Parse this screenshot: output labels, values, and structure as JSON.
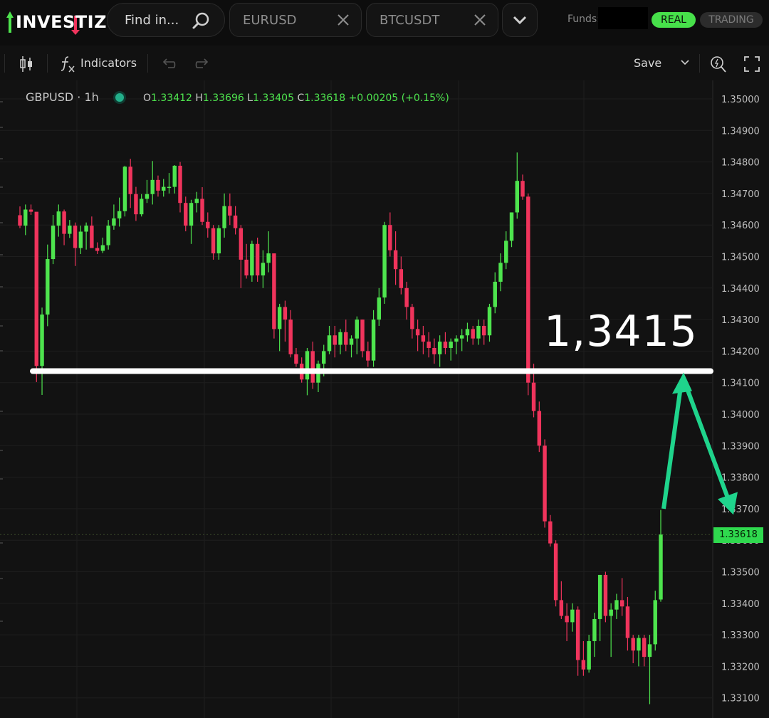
{
  "app": {
    "logo_text": "INVESTIZO"
  },
  "search": {
    "label": "Find in..."
  },
  "symbol_tabs": [
    {
      "label": "EURUSD"
    },
    {
      "label": "BTCUSDT"
    }
  ],
  "header": {
    "funds_label": "Funds:",
    "real_label": "REAL",
    "trading_label": "TRADING"
  },
  "toolbar": {
    "indicators_label": "Indicators",
    "save_label": "Save"
  },
  "legend": {
    "symbol_interval": "GBPUSD · 1h",
    "open_key": "O",
    "open": "1.33412",
    "high_key": "H",
    "high": "1.33696",
    "low_key": "L",
    "low": "1.33405",
    "close_key": "C",
    "close": "1.33618",
    "change": "+0.00205 (+0.15%)"
  },
  "annotation": {
    "level_text": "1,3415"
  },
  "colors": {
    "up": "#4ee44e",
    "down": "#f0345c",
    "accent": "#2fd94e",
    "arrow": "#1fd48c"
  },
  "chart_data": {
    "type": "candlestick",
    "symbol": "GBPUSD",
    "interval": "1h",
    "ylim": [
      1.3307,
      1.3503
    ],
    "y_ticks": [
      "1.35000",
      "1.34900",
      "1.34800",
      "1.34700",
      "1.34600",
      "1.34500",
      "1.34400",
      "1.34300",
      "1.34200",
      "1.34100",
      "1.34000",
      "1.33900",
      "1.33800",
      "1.33700",
      "1.33600",
      "1.33500",
      "1.33400",
      "1.33300",
      "1.33200",
      "1.33100"
    ],
    "last_price": "1.33618",
    "horizontal_level": 1.3415,
    "ohlc": [
      [
        1.34631,
        1.34659,
        1.3459,
        1.34598
      ],
      [
        1.34598,
        1.34665,
        1.34568,
        1.34649
      ],
      [
        1.34649,
        1.34665,
        1.34632,
        1.34642
      ],
      [
        1.34642,
        1.34641,
        1.34102,
        1.34153
      ],
      [
        1.34153,
        1.34338,
        1.34061,
        1.34316
      ],
      [
        1.34316,
        1.34538,
        1.34279,
        1.34492
      ],
      [
        1.34492,
        1.34632,
        1.34476,
        1.34598
      ],
      [
        1.34598,
        1.34665,
        1.34563,
        1.34643
      ],
      [
        1.34643,
        1.34649,
        1.34536,
        1.34572
      ],
      [
        1.34572,
        1.34616,
        1.34559,
        1.34598
      ],
      [
        1.34598,
        1.34608,
        1.3447,
        1.34527
      ],
      [
        1.34527,
        1.34598,
        1.34508,
        1.34579
      ],
      [
        1.34579,
        1.34608,
        1.34522,
        1.34598
      ],
      [
        1.34598,
        1.34627,
        1.34536,
        1.34527
      ],
      [
        1.34527,
        1.34545,
        1.34508,
        1.34518
      ],
      [
        1.34518,
        1.3456,
        1.34511,
        1.34536
      ],
      [
        1.34536,
        1.34616,
        1.34522,
        1.34598
      ],
      [
        1.34598,
        1.34665,
        1.34585,
        1.34621
      ],
      [
        1.34621,
        1.34687,
        1.34595,
        1.34644
      ],
      [
        1.34644,
        1.34788,
        1.34627,
        1.34785
      ],
      [
        1.34785,
        1.3481,
        1.34654,
        1.34698
      ],
      [
        1.34698,
        1.34721,
        1.34613,
        1.34634
      ],
      [
        1.34634,
        1.34698,
        1.34627,
        1.34683
      ],
      [
        1.34683,
        1.34743,
        1.3467,
        1.34698
      ],
      [
        1.34698,
        1.34803,
        1.34665,
        1.34743
      ],
      [
        1.34743,
        1.34757,
        1.3469,
        1.34709
      ],
      [
        1.34709,
        1.34746,
        1.3469,
        1.34721
      ],
      [
        1.34721,
        1.34765,
        1.347,
        1.34721
      ],
      [
        1.34721,
        1.3479,
        1.347,
        1.34788
      ],
      [
        1.34788,
        1.348,
        1.3464,
        1.3467
      ],
      [
        1.3467,
        1.3469,
        1.3458,
        1.34598
      ],
      [
        1.34598,
        1.3468,
        1.3454,
        1.3467
      ],
      [
        1.3467,
        1.34705,
        1.3464,
        1.34683
      ],
      [
        1.34683,
        1.3472,
        1.346,
        1.3461
      ],
      [
        1.3461,
        1.3464,
        1.3456,
        1.3459
      ],
      [
        1.3459,
        1.346,
        1.3449,
        1.3451
      ],
      [
        1.3451,
        1.346,
        1.3449,
        1.3459
      ],
      [
        1.3459,
        1.347,
        1.3456,
        1.3466
      ],
      [
        1.3466,
        1.347,
        1.346,
        1.3463
      ],
      [
        1.3463,
        1.3466,
        1.3457,
        1.3459
      ],
      [
        1.3459,
        1.346,
        1.344,
        1.3449
      ],
      [
        1.3449,
        1.3454,
        1.3443,
        1.3444
      ],
      [
        1.3444,
        1.3455,
        1.3442,
        1.3454
      ],
      [
        1.3454,
        1.3456,
        1.3442,
        1.3444
      ],
      [
        1.3444,
        1.3452,
        1.344,
        1.3448
      ],
      [
        1.3448,
        1.3458,
        1.3445,
        1.3451
      ],
      [
        1.3451,
        1.3451,
        1.3424,
        1.3427
      ],
      [
        1.3427,
        1.3435,
        1.342,
        1.3434
      ],
      [
        1.3434,
        1.3436,
        1.3423,
        1.343
      ],
      [
        1.343,
        1.3433,
        1.3418,
        1.3419
      ],
      [
        1.3419,
        1.3421,
        1.3415,
        1.3416
      ],
      [
        1.3416,
        1.3418,
        1.341,
        1.3411
      ],
      [
        1.3411,
        1.3421,
        1.3406,
        1.342
      ],
      [
        1.342,
        1.3423,
        1.3408,
        1.341
      ],
      [
        1.341,
        1.3417,
        1.3407,
        1.3416
      ],
      [
        1.3416,
        1.3422,
        1.3412,
        1.342
      ],
      [
        1.342,
        1.3428,
        1.3419,
        1.3425
      ],
      [
        1.3425,
        1.3428,
        1.3418,
        1.3422
      ],
      [
        1.3422,
        1.3427,
        1.3419,
        1.3426
      ],
      [
        1.3426,
        1.343,
        1.342,
        1.3422
      ],
      [
        1.3422,
        1.3425,
        1.3418,
        1.3424
      ],
      [
        1.3424,
        1.3431,
        1.3419,
        1.343
      ],
      [
        1.343,
        1.343,
        1.3418,
        1.342
      ],
      [
        1.342,
        1.3423,
        1.3415,
        1.3417
      ],
      [
        1.3417,
        1.3433,
        1.3415,
        1.343
      ],
      [
        1.343,
        1.344,
        1.3428,
        1.3437
      ],
      [
        1.3437,
        1.3461,
        1.3435,
        1.346
      ],
      [
        1.346,
        1.3464,
        1.345,
        1.3452
      ],
      [
        1.3452,
        1.3458,
        1.3441,
        1.3446
      ],
      [
        1.3446,
        1.345,
        1.3438,
        1.344
      ],
      [
        1.344,
        1.3442,
        1.343,
        1.3434
      ],
      [
        1.3434,
        1.3435,
        1.3424,
        1.3427
      ],
      [
        1.3427,
        1.343,
        1.342,
        1.3425
      ],
      [
        1.3425,
        1.3428,
        1.3419,
        1.3423
      ],
      [
        1.3423,
        1.3426,
        1.3418,
        1.3421
      ],
      [
        1.3421,
        1.3424,
        1.3416,
        1.3419
      ],
      [
        1.3419,
        1.3425,
        1.3415,
        1.3423
      ],
      [
        1.3423,
        1.3426,
        1.3419,
        1.3421
      ],
      [
        1.3421,
        1.3424,
        1.3417,
        1.3423
      ],
      [
        1.3423,
        1.3425,
        1.3419,
        1.3424
      ],
      [
        1.3424,
        1.3427,
        1.342,
        1.3425
      ],
      [
        1.3425,
        1.3429,
        1.3423,
        1.3427
      ],
      [
        1.3427,
        1.3428,
        1.3422,
        1.3424
      ],
      [
        1.3424,
        1.343,
        1.3422,
        1.3428
      ],
      [
        1.3428,
        1.343,
        1.3422,
        1.3425
      ],
      [
        1.3425,
        1.3435,
        1.3423,
        1.3434
      ],
      [
        1.3434,
        1.3445,
        1.3432,
        1.3442
      ],
      [
        1.3442,
        1.3451,
        1.3439,
        1.3448
      ],
      [
        1.3448,
        1.3458,
        1.3446,
        1.3455
      ],
      [
        1.3455,
        1.3464,
        1.3453,
        1.3464
      ],
      [
        1.3464,
        1.3483,
        1.3462,
        1.3474
      ],
      [
        1.3474,
        1.3476,
        1.3468,
        1.3469
      ],
      [
        1.3469,
        1.347,
        1.3406,
        1.341
      ],
      [
        1.341,
        1.3416,
        1.3399,
        1.3401
      ],
      [
        1.3401,
        1.3404,
        1.3388,
        1.339
      ],
      [
        1.339,
        1.3392,
        1.3364,
        1.3366
      ],
      [
        1.3366,
        1.3368,
        1.3358,
        1.3359
      ],
      [
        1.3359,
        1.336,
        1.3339,
        1.3341
      ],
      [
        1.3341,
        1.3347,
        1.3335,
        1.3336
      ],
      [
        1.3336,
        1.334,
        1.3328,
        1.3334
      ],
      [
        1.3334,
        1.334,
        1.3331,
        1.3338
      ],
      [
        1.3338,
        1.3339,
        1.3317,
        1.3322
      ],
      [
        1.3322,
        1.3328,
        1.3317,
        1.3319
      ],
      [
        1.3319,
        1.333,
        1.3318,
        1.3328
      ],
      [
        1.3328,
        1.3337,
        1.3323,
        1.3335
      ],
      [
        1.3335,
        1.3349,
        1.3328,
        1.3349
      ],
      [
        1.3349,
        1.335,
        1.3334,
        1.3336
      ],
      [
        1.3336,
        1.334,
        1.3323,
        1.3338
      ],
      [
        1.3338,
        1.3343,
        1.3335,
        1.3341
      ],
      [
        1.3341,
        1.3348,
        1.3336,
        1.3339
      ],
      [
        1.3339,
        1.3342,
        1.3325,
        1.3329
      ],
      [
        1.3329,
        1.333,
        1.3321,
        1.3325
      ],
      [
        1.3325,
        1.333,
        1.332,
        1.3329
      ],
      [
        1.3329,
        1.333,
        1.332,
        1.3323
      ],
      [
        1.3323,
        1.333,
        1.3308,
        1.3327
      ],
      [
        1.3327,
        1.3344,
        1.3325,
        1.3341
      ],
      [
        1.33412,
        1.33696,
        1.33405,
        1.33618
      ]
    ]
  }
}
